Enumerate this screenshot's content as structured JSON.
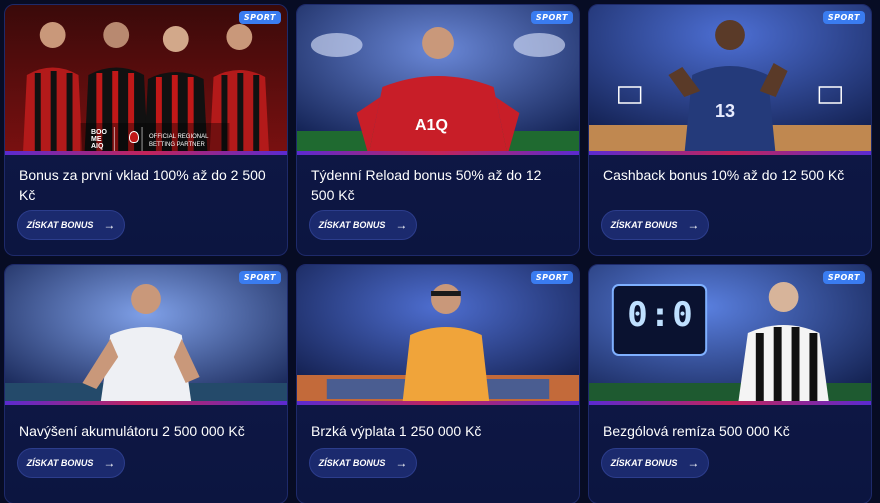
{
  "cards": [
    {
      "badge": "SPORT",
      "title": "Bonus za první vklad 100% až do 2 500 Kč",
      "button": "ZÍSKAT BONUS",
      "arrow": "→",
      "overlay": {
        "line1": "BOO",
        "line2": "ME",
        "line3": "AIQ",
        "text1": "OFFICIAL REGIONAL",
        "text2": "BETTING PARTNER"
      }
    },
    {
      "badge": "SPORT",
      "title": "Týdenní Reload bonus 50% až do 12 500 Kč",
      "button": "ZÍSKAT BONUS",
      "arrow": "→",
      "jersey": "A1Q"
    },
    {
      "badge": "SPORT",
      "title": "Cashback bonus 10% až do 12 500 Kč",
      "button": "ZÍSKAT BONUS",
      "arrow": "→",
      "jersey": "13"
    },
    {
      "badge": "SPORT",
      "title": "Navýšení akumulátoru 2 500 000 Kč",
      "button": "ZÍSKAT BONUS",
      "arrow": "→"
    },
    {
      "badge": "SPORT",
      "title": "Brzká výplata 1 250 000 Kč",
      "button": "ZÍSKAT BONUS",
      "arrow": "→"
    },
    {
      "badge": "SPORT",
      "title": "Bezgólová remíza 500 000 Kč",
      "button": "ZÍSKAT BONUS",
      "arrow": "→",
      "scoreboard": "0:0"
    }
  ]
}
